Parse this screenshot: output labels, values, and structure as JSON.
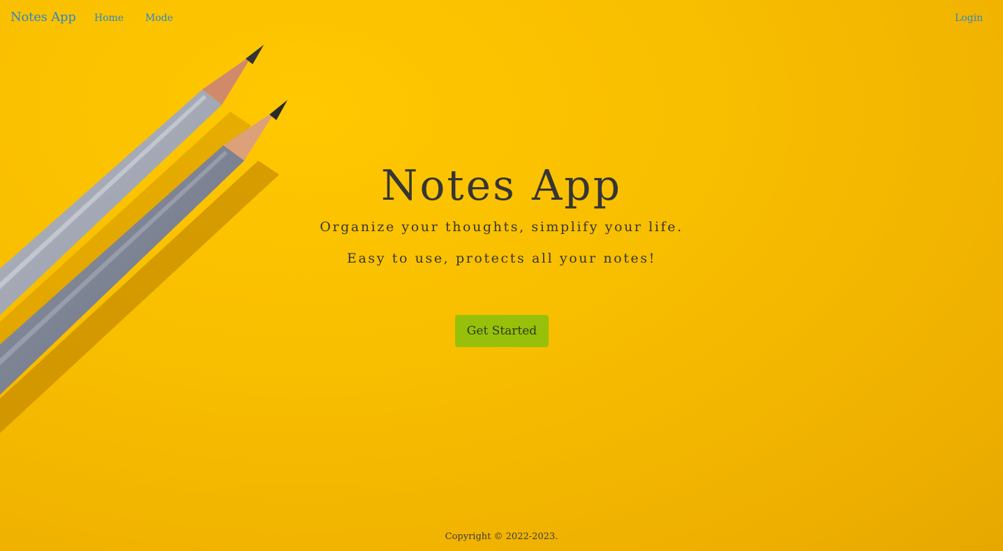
{
  "navbar": {
    "brand": "Notes App",
    "links": [
      "Home",
      "Mode"
    ],
    "login": "Login"
  },
  "hero": {
    "title": "Notes App",
    "subtitle": "Organize your thoughts, simplify your life.",
    "tagline": "Easy to use, protects all your notes!",
    "cta": "Get Started"
  },
  "footer": {
    "copyright": "Copyright © 2022-2023."
  },
  "colors": {
    "background": "#f5b800",
    "link": "#2b87c9",
    "cta_bg": "#97c00a",
    "text": "#353535"
  }
}
